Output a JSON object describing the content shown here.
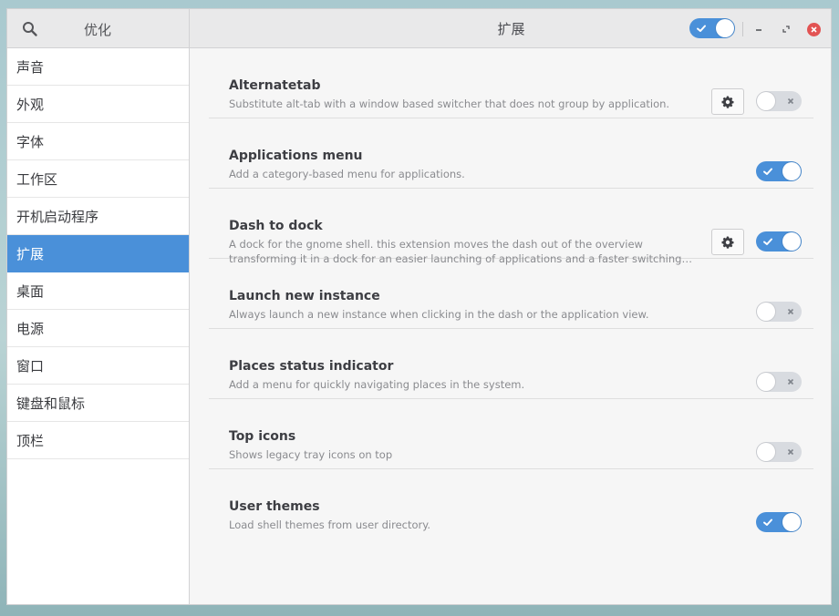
{
  "header": {
    "app_title": "优化",
    "page_title": "扩展",
    "extensions_enabled": true
  },
  "sidebar": {
    "items": [
      {
        "label": "声音"
      },
      {
        "label": "外观"
      },
      {
        "label": "字体"
      },
      {
        "label": "工作区"
      },
      {
        "label": "开机启动程序"
      },
      {
        "label": "扩展",
        "active": true
      },
      {
        "label": "桌面"
      },
      {
        "label": "电源"
      },
      {
        "label": "窗口"
      },
      {
        "label": "键盘和鼠标"
      },
      {
        "label": "顶栏"
      }
    ]
  },
  "extensions": [
    {
      "name": "Alternatetab",
      "description": "Substitute alt-tab with a window based switcher that does not group by application.",
      "enabled": false,
      "has_settings": true
    },
    {
      "name": "Applications menu",
      "description": "Add a category-based menu for applications.",
      "enabled": true,
      "has_settings": false
    },
    {
      "name": "Dash to dock",
      "description": "A dock for the gnome shell. this extension moves the dash out of the overview transforming it in a dock for an easier launching of applications and a faster switching between windows and desktops.",
      "enabled": true,
      "has_settings": true
    },
    {
      "name": "Launch new instance",
      "description": "Always launch a new instance when clicking in the dash or the application view.",
      "enabled": false,
      "has_settings": false
    },
    {
      "name": "Places status indicator",
      "description": "Add a menu for quickly navigating places in the system.",
      "enabled": false,
      "has_settings": false
    },
    {
      "name": "Top icons",
      "description": "Shows legacy tray icons on top",
      "enabled": false,
      "has_settings": false
    },
    {
      "name": "User themes",
      "description": "Load shell themes from user directory.",
      "enabled": true,
      "has_settings": false
    }
  ],
  "colors": {
    "accent": "#4a90d9",
    "switch_off": "#d8dbe0",
    "close": "#e25353"
  },
  "icons": [
    "search-icon",
    "minimize-icon",
    "maximize-icon",
    "close-icon",
    "gear-icon",
    "check-icon",
    "x-icon"
  ]
}
